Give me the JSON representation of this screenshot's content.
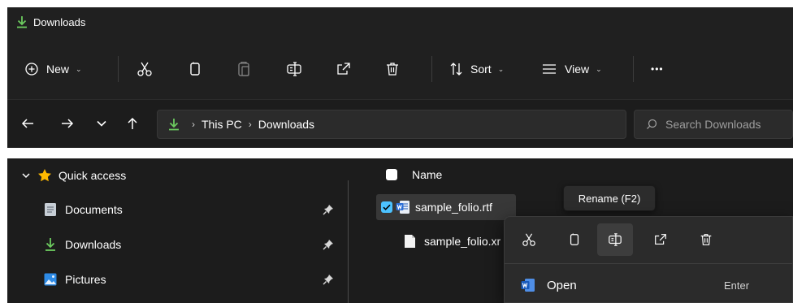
{
  "window": {
    "title": "Downloads"
  },
  "toolbar": {
    "new_label": "New",
    "sort_label": "Sort",
    "view_label": "View",
    "more_label": "•••",
    "caret": "⌄"
  },
  "address": {
    "crumbs": [
      "This PC",
      "Downloads"
    ],
    "separator": "›",
    "search_placeholder": "Search Downloads"
  },
  "nav_pane": {
    "quick_access_label": "Quick access",
    "items": [
      {
        "label": "Documents",
        "icon": "documents-icon"
      },
      {
        "label": "Downloads",
        "icon": "downloads-icon"
      },
      {
        "label": "Pictures",
        "icon": "pictures-icon"
      }
    ]
  },
  "file_list": {
    "column_name": "Name",
    "files": [
      {
        "name": "sample_folio.rtf",
        "selected": true
      },
      {
        "name": "sample_folio.xr",
        "selected": false
      }
    ]
  },
  "tooltip": {
    "text": "Rename (F2)"
  },
  "context_menu": {
    "open_label": "Open",
    "open_shortcut": "Enter"
  },
  "colors": {
    "accent": "#4cc2ff",
    "download_arrow": "#6ccb5f",
    "star": "#ffb900",
    "bg_dark": "#1c1c1c",
    "bg_title": "#202020"
  }
}
